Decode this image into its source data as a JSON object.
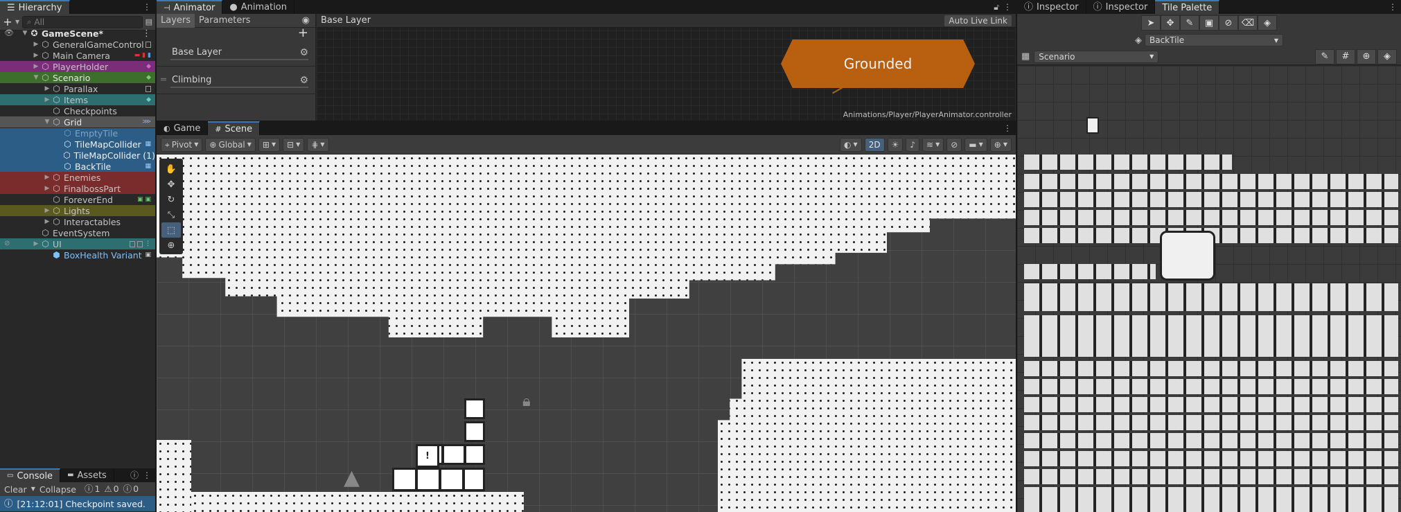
{
  "hierarchy": {
    "tab_label": "Hierarchy",
    "search_placeholder": "All",
    "add_label": "+",
    "items": [
      {
        "label": "GameScene*",
        "bold": true
      },
      {
        "label": "GeneralGameControl"
      },
      {
        "label": "Main Camera"
      },
      {
        "label": "PlayerHolder"
      },
      {
        "label": "Scenario"
      },
      {
        "label": "Parallax"
      },
      {
        "label": "Items"
      },
      {
        "label": "Checkpoints"
      },
      {
        "label": "Grid"
      },
      {
        "label": "EmptyTile"
      },
      {
        "label": "TileMapCollider"
      },
      {
        "label": "TileMapCollider (1)"
      },
      {
        "label": "BackTile"
      },
      {
        "label": "Enemies"
      },
      {
        "label": "FinalbossPart"
      },
      {
        "label": "ForeverEnd"
      },
      {
        "label": "Lights"
      },
      {
        "label": "Interactables"
      },
      {
        "label": "EventSystem"
      },
      {
        "label": "UI"
      },
      {
        "label": "BoxHealth Variant"
      }
    ]
  },
  "animator": {
    "tabs": [
      {
        "label": "Animator"
      },
      {
        "label": "Animation"
      }
    ],
    "subtabs": [
      {
        "label": "Layers"
      },
      {
        "label": "Parameters"
      }
    ],
    "breadcrumb": "Base Layer",
    "auto_live_link": "Auto Live Link",
    "layers": [
      {
        "label": "Base Layer"
      },
      {
        "label": "Climbing"
      }
    ],
    "state_label": "Grounded",
    "controller_path": "Animations/Player/PlayerAnimator.controller",
    "state_color": "#b8600f"
  },
  "scene": {
    "tabs": [
      {
        "label": "Game"
      },
      {
        "label": "Scene"
      }
    ],
    "pivot_label": "Pivot",
    "global_label": "Global",
    "mode_2d_label": "2D"
  },
  "console": {
    "tabs": [
      {
        "label": "Console"
      },
      {
        "label": "Assets"
      }
    ],
    "clear_label": "Clear",
    "collapse_label": "Collapse",
    "info_count": "1",
    "warning_count": "0",
    "error_count": "0",
    "status_message": "[21:12:01] Checkpoint saved."
  },
  "inspector": {
    "tabs": [
      {
        "label": "Inspector"
      },
      {
        "label": "Inspector"
      },
      {
        "label": "Tile Palette"
      }
    ],
    "active_tilemap": "BackTile",
    "palette_name": "Scenario"
  },
  "colors": {
    "accent": "#3a79bb",
    "selection": "#2c5d87",
    "prefab_blue": "#7cc1ff",
    "pink_row": "#7a2e7a",
    "green_row": "#3d6e2c",
    "teal_row": "#2d6f70",
    "red_row": "#7a2c2c",
    "olive_row": "#5a5a20"
  }
}
